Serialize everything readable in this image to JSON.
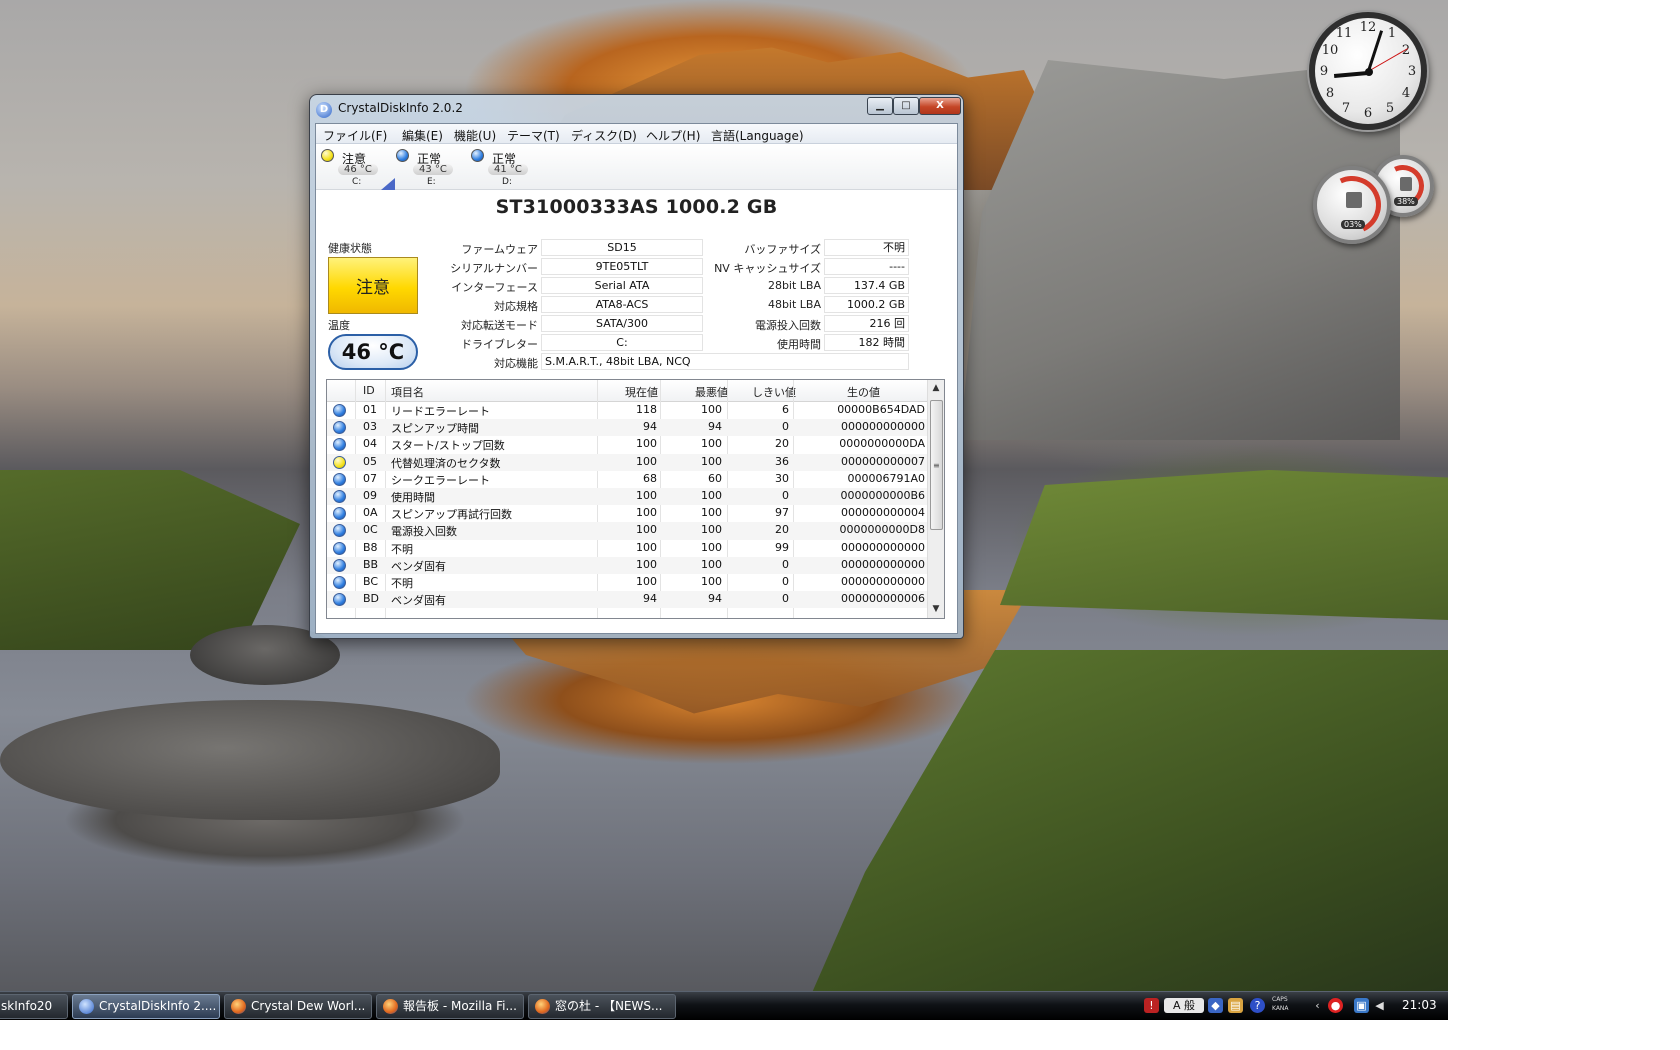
{
  "window": {
    "title": "CrystalDiskInfo 2.0.2",
    "icon_letter": "D",
    "minimize": "▁",
    "maximize": "□",
    "close": "X"
  },
  "menu": [
    "ファイル(F)",
    "編集(E)",
    "機能(U)",
    "テーマ(T)",
    "ディスク(D)",
    "ヘルプ(H)",
    "言語(Language)"
  ],
  "disks": [
    {
      "status": "注意",
      "temp": "46 °C",
      "letter": "C:",
      "color": "#f5e21b"
    },
    {
      "status": "正常",
      "temp": "43 °C",
      "letter": "E:",
      "color": "#2f7ee0"
    },
    {
      "status": "正常",
      "temp": "41 °C",
      "letter": "D:",
      "color": "#2f7ee0"
    }
  ],
  "model": "ST31000333AS  1000.2 GB",
  "health": {
    "label": "健康状態",
    "value": "注意"
  },
  "temperature": {
    "label": "温度",
    "value": "46 °C"
  },
  "info_left": [
    {
      "label": "ファームウェア",
      "value": "SD15"
    },
    {
      "label": "シリアルナンバー",
      "value": "9TE05TLT"
    },
    {
      "label": "インターフェース",
      "value": "Serial ATA"
    },
    {
      "label": "対応規格",
      "value": "ATA8-ACS"
    },
    {
      "label": "対応転送モード",
      "value": "SATA/300"
    },
    {
      "label": "ドライブレター",
      "value": "C:"
    }
  ],
  "info_right": [
    {
      "label": "バッファサイズ",
      "value": "不明"
    },
    {
      "label": "NV キャッシュサイズ",
      "value": "----"
    },
    {
      "label": "28bit LBA",
      "value": "137.4 GB"
    },
    {
      "label": "48bit LBA",
      "value": "1000.2 GB"
    },
    {
      "label": "電源投入回数",
      "value": "216 回"
    },
    {
      "label": "使用時間",
      "value": "182 時間"
    }
  ],
  "features": {
    "label": "対応機能",
    "value": "S.M.A.R.T., 48bit LBA, NCQ"
  },
  "smart_table": {
    "headers": [
      "ID",
      "項目名",
      "現在値",
      "最悪値",
      "しきい値",
      "生の値"
    ],
    "rows": [
      {
        "id": "01",
        "name": "リードエラーレート",
        "cur": "118",
        "worst": "100",
        "thr": "6",
        "raw": "00000B654DAD",
        "status": "blue"
      },
      {
        "id": "03",
        "name": "スピンアップ時間",
        "cur": "94",
        "worst": "94",
        "thr": "0",
        "raw": "000000000000",
        "status": "blue"
      },
      {
        "id": "04",
        "name": "スタート/ストップ回数",
        "cur": "100",
        "worst": "100",
        "thr": "20",
        "raw": "0000000000DA",
        "status": "blue"
      },
      {
        "id": "05",
        "name": "代替処理済のセクタ数",
        "cur": "100",
        "worst": "100",
        "thr": "36",
        "raw": "000000000007",
        "status": "yellow"
      },
      {
        "id": "07",
        "name": "シークエラーレート",
        "cur": "68",
        "worst": "60",
        "thr": "30",
        "raw": "000006791A0",
        "status": "blue"
      },
      {
        "id": "09",
        "name": "使用時間",
        "cur": "100",
        "worst": "100",
        "thr": "0",
        "raw": "0000000000B6",
        "status": "blue"
      },
      {
        "id": "0A",
        "name": "スピンアップ再試行回数",
        "cur": "100",
        "worst": "100",
        "thr": "97",
        "raw": "000000000004",
        "status": "blue"
      },
      {
        "id": "0C",
        "name": "電源投入回数",
        "cur": "100",
        "worst": "100",
        "thr": "20",
        "raw": "0000000000D8",
        "status": "blue"
      },
      {
        "id": "B8",
        "name": "不明",
        "cur": "100",
        "worst": "100",
        "thr": "99",
        "raw": "000000000000",
        "status": "blue"
      },
      {
        "id": "BB",
        "name": "ベンダ固有",
        "cur": "100",
        "worst": "100",
        "thr": "0",
        "raw": "000000000000",
        "status": "blue"
      },
      {
        "id": "BC",
        "name": "不明",
        "cur": "100",
        "worst": "100",
        "thr": "0",
        "raw": "000000000000",
        "status": "blue"
      },
      {
        "id": "BD",
        "name": "ベンダ固有",
        "cur": "94",
        "worst": "94",
        "thr": "0",
        "raw": "000000000006",
        "status": "blue"
      }
    ]
  },
  "clock_gadget": {
    "numbers": [
      "12",
      "1",
      "2",
      "3",
      "4",
      "5",
      "6",
      "7",
      "8",
      "9",
      "10",
      "11"
    ]
  },
  "meter_gadget": {
    "cpu": "03%",
    "mem": "38%"
  },
  "taskbar": {
    "tasks": [
      {
        "label": "skInfo20",
        "icon": "folder"
      },
      {
        "label": "CrystalDiskInfo 2....",
        "icon": "crystaldiskinfo"
      },
      {
        "label": "Crystal Dew Worl...",
        "icon": "firefox"
      },
      {
        "label": "報告板 - Mozilla Fi...",
        "icon": "firefox"
      },
      {
        "label": "窓の杜 - 【NEWS...",
        "icon": "firefox"
      }
    ],
    "ime": "A 般",
    "caps": "CAPS",
    "kana": "KANA",
    "time": "21:03"
  },
  "colors": {
    "caution": "#f5e21b",
    "good": "#2f7ee0",
    "close": "#c54626"
  }
}
